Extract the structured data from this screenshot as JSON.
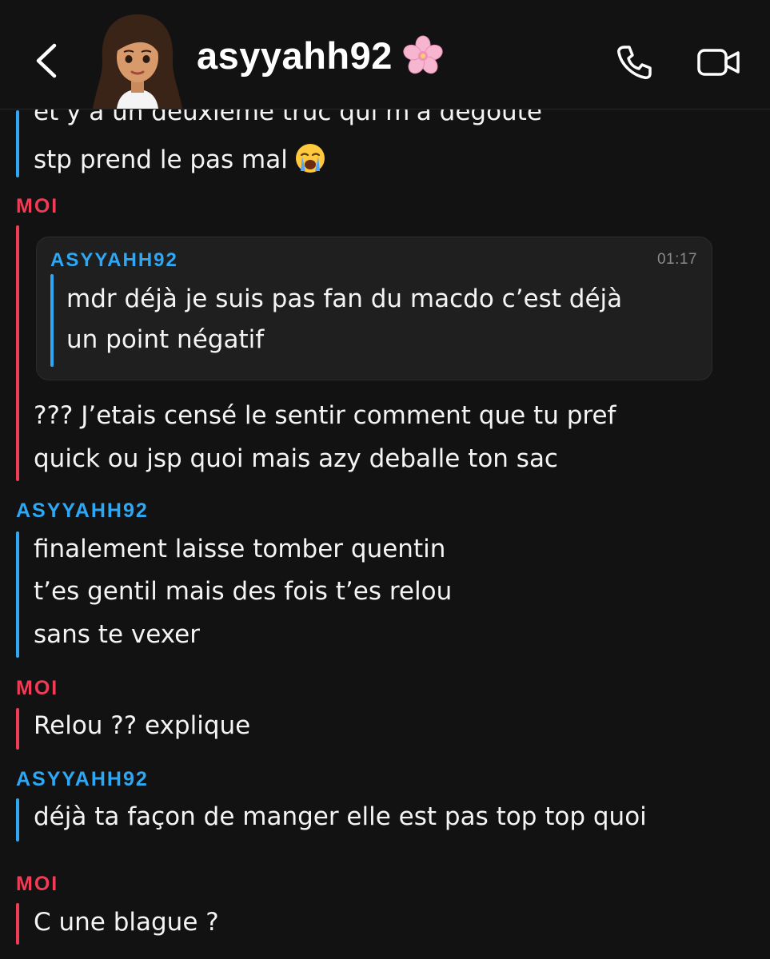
{
  "header": {
    "contact_name": "asyyahh92",
    "name_emoji_icon": "cherry-blossom-icon",
    "back_icon": "chevron-left-icon",
    "call_icon": "phone-icon",
    "video_icon": "video-camera-icon"
  },
  "colors": {
    "me": "#f23c57",
    "them": "#2ea7f5",
    "background": "#121212"
  },
  "messages": [
    {
      "sender": "",
      "lines": [
        "et y a un deuxième truc qui m'a dégoûté",
        "stp prend le pas mal"
      ],
      "emoji_icon": "loudly-crying-face-icon"
    },
    {
      "sender": "MOI",
      "quote": {
        "sender": "ASYYAHH92",
        "time": "01:17",
        "lines": [
          "mdr déjà je suis pas fan du macdo c’est déjà",
          "un point négatif"
        ]
      },
      "lines": [
        "??? J’etais censé le sentir comment que tu pref",
        "quick ou jsp quoi mais azy deballe ton sac"
      ]
    },
    {
      "sender": "ASYYAHH92",
      "lines": [
        "finalement laisse tomber quentin",
        "t’es gentil mais des fois t’es relou",
        "sans te vexer"
      ]
    },
    {
      "sender": "MOI",
      "lines": [
        "Relou ?? explique"
      ]
    },
    {
      "sender": "ASYYAHH92",
      "lines": [
        "déjà ta façon de manger elle est pas top top quoi"
      ]
    },
    {
      "sender": "MOI",
      "lines": [
        "C une blague ?"
      ]
    }
  ]
}
